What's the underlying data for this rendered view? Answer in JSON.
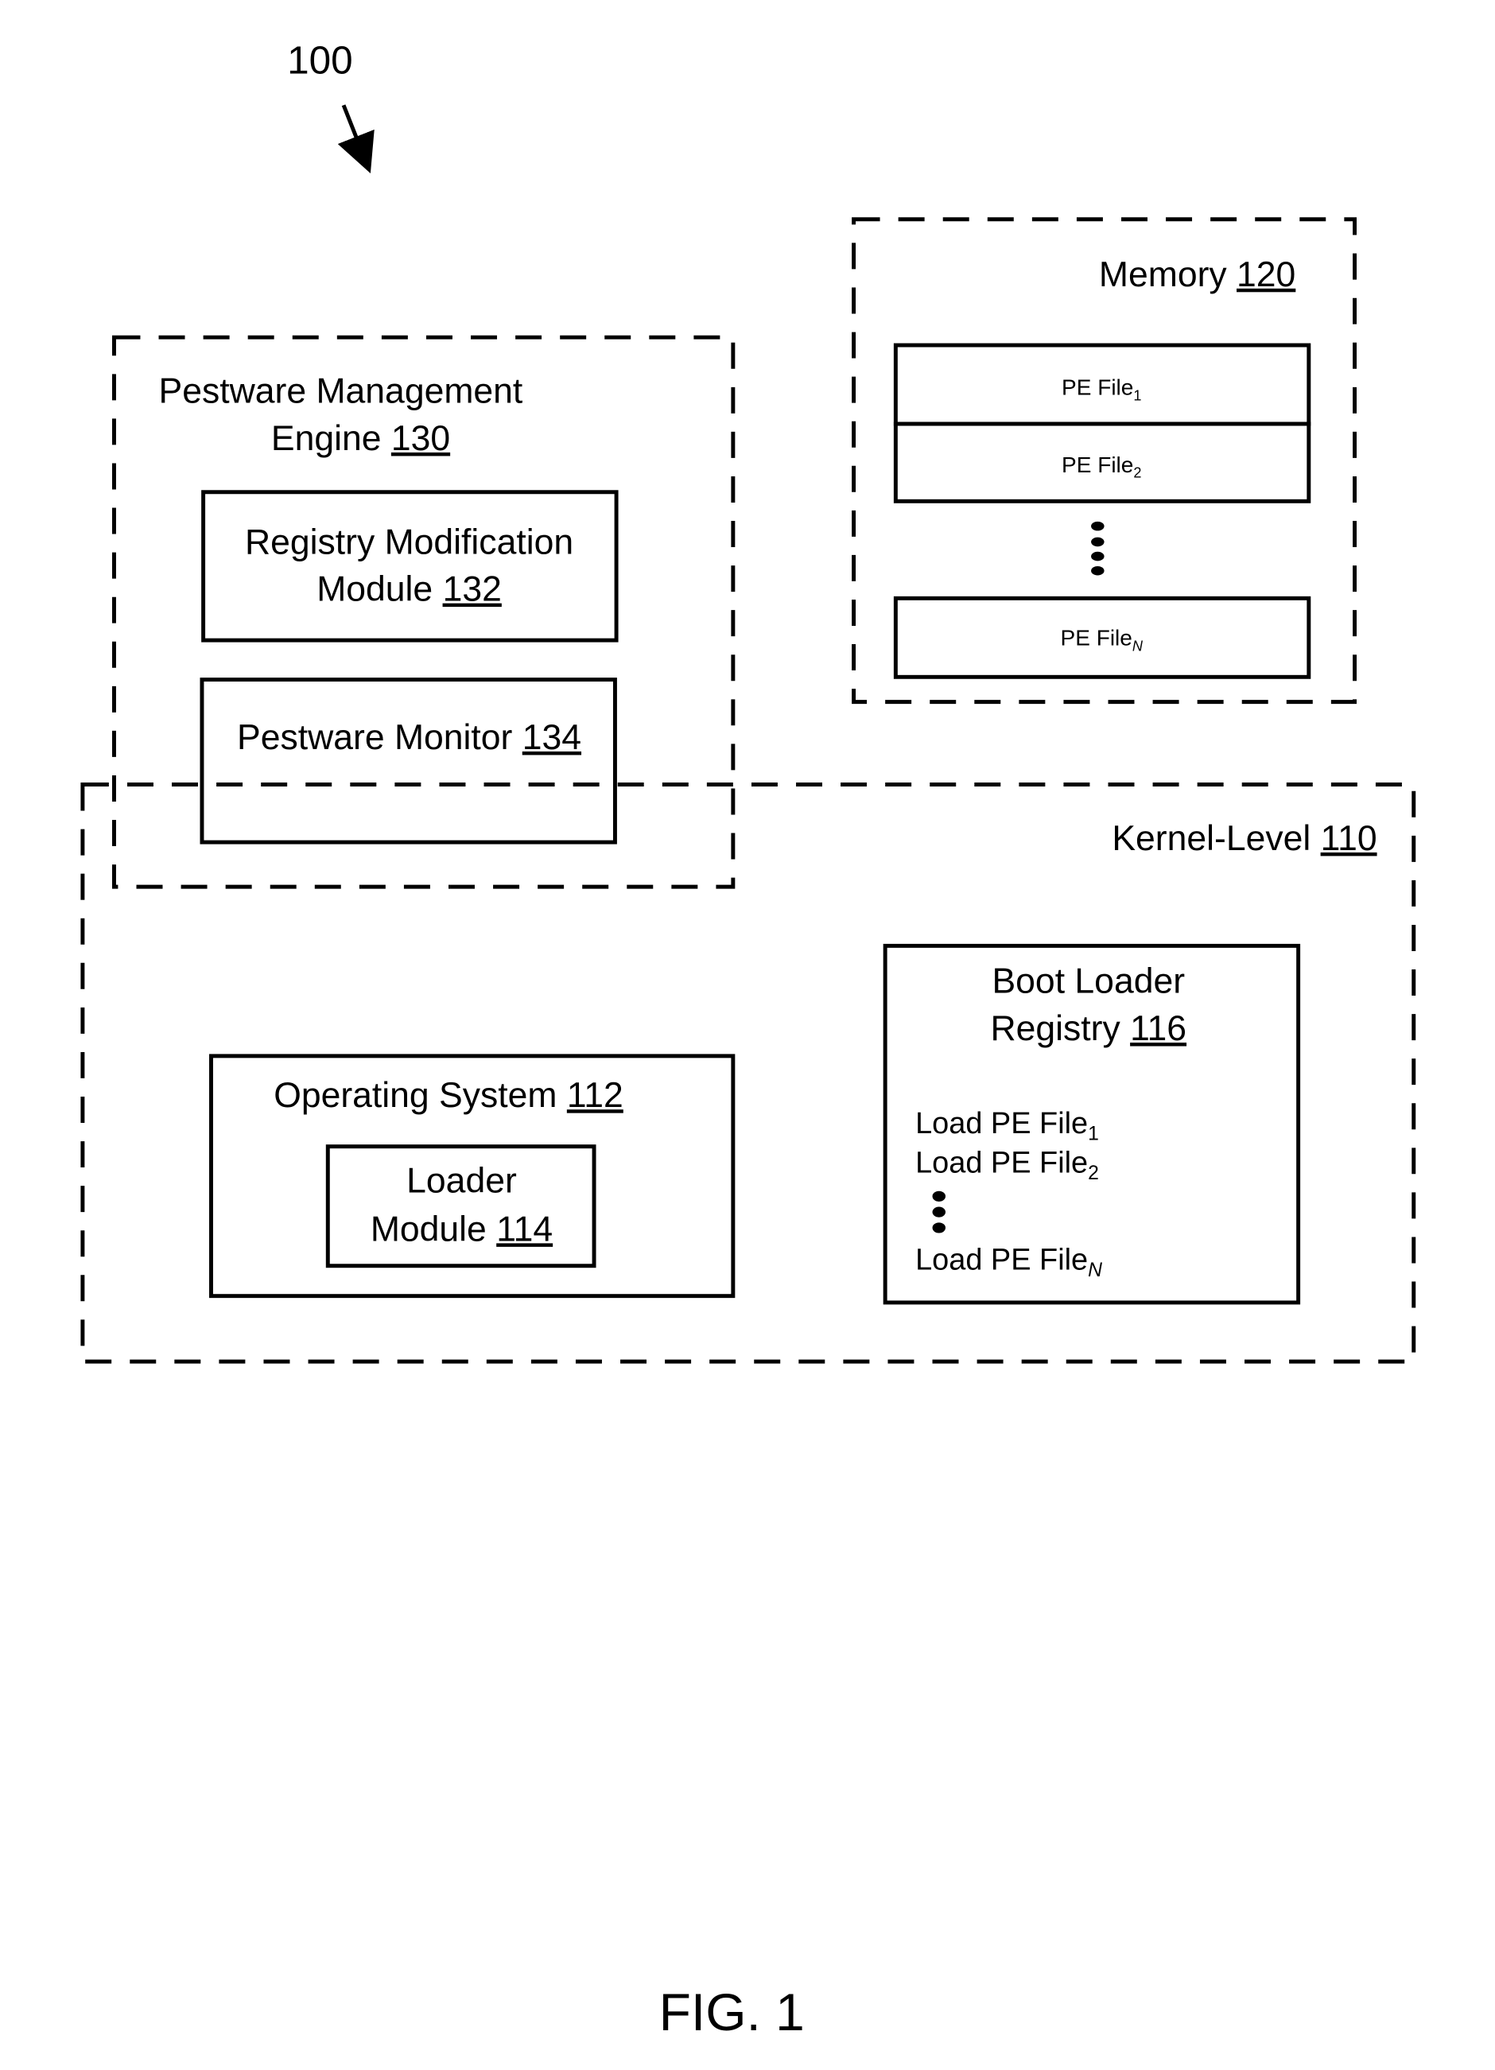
{
  "figure": {
    "reference": "100",
    "caption": "FIG. 1"
  },
  "memory": {
    "label": "Memory ",
    "ref": "120",
    "files": [
      {
        "base": "PE File",
        "sub": "1"
      },
      {
        "base": "PE File",
        "sub": "2"
      },
      {
        "base": "PE File",
        "sub": "N"
      }
    ]
  },
  "pestware_engine": {
    "line1": "Pestware Management",
    "line2": "Engine ",
    "ref": "130",
    "registry_module": {
      "line1": "Registry  Modification",
      "line2": "Module ",
      "ref": "132"
    },
    "monitor": {
      "label": "Pestware Monitor ",
      "ref": "134"
    }
  },
  "kernel": {
    "label": "Kernel-Level ",
    "ref": "110",
    "os": {
      "label": "Operating System ",
      "ref": "112",
      "loader": {
        "line1": "Loader",
        "line2": "Module ",
        "ref": "114"
      }
    },
    "boot_registry": {
      "line1": "Boot Loader",
      "line2": "Registry ",
      "ref": "116",
      "entries": [
        {
          "base": "Load PE File",
          "sub": "1"
        },
        {
          "base": "Load PE File",
          "sub": "2"
        },
        {
          "base": "Load PE File",
          "sub": "N"
        }
      ]
    }
  }
}
